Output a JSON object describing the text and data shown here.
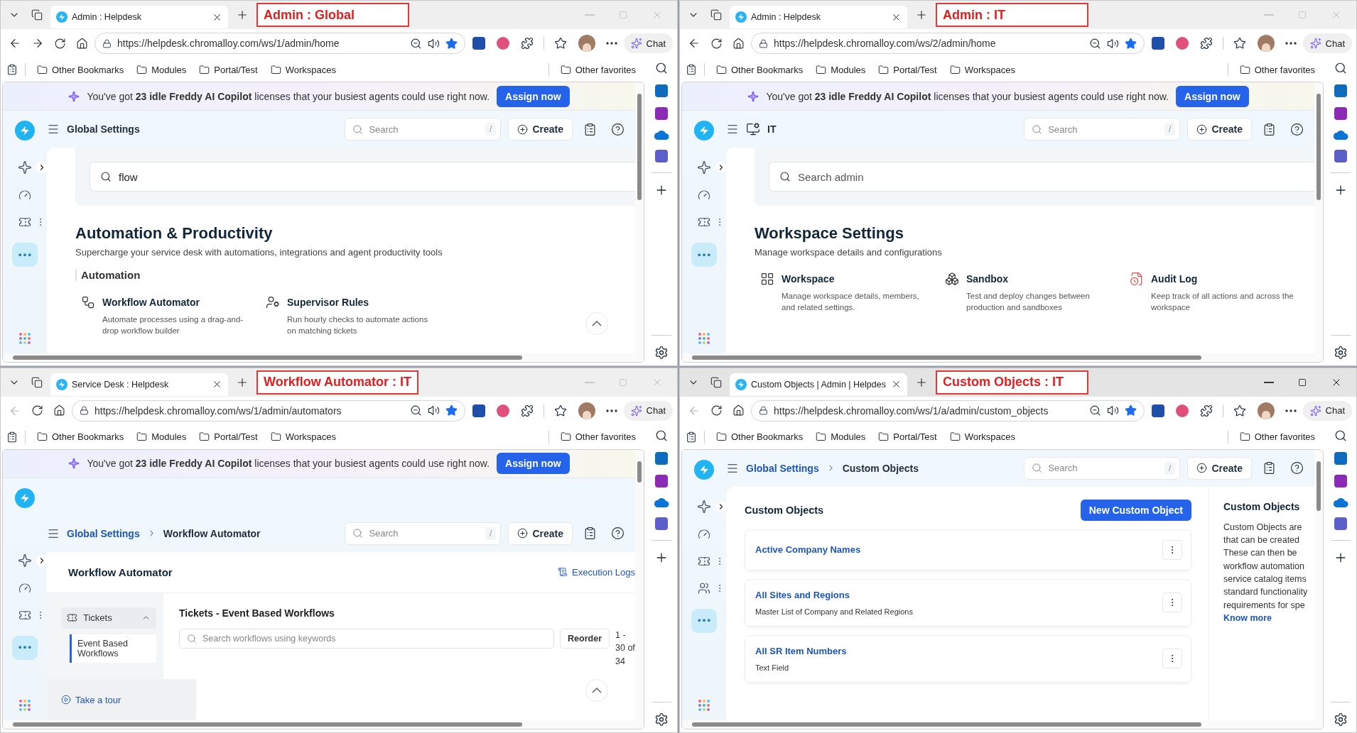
{
  "windows": [
    {
      "tab_title": "Admin : Helpdesk",
      "annotation": "Admin : Global",
      "focused": false,
      "back_enabled": true,
      "forward_button": true,
      "url": "https://helpdesk.chromalloy.com/ws/1/admin/home",
      "chat": "Chat",
      "bookmarks": [
        "Other Bookmarks",
        "Modules",
        "Portal/Test",
        "Workspaces"
      ],
      "other_favorites": "Other favorites",
      "banner": {
        "text": "You've got **23 idle Freddy AI Copilot** licenses that your busiest agents could use right now.",
        "button": "Assign now"
      },
      "header": {
        "workspace_icon": false,
        "breadcrumbs": [
          {
            "label": "Global Settings",
            "link": false
          }
        ],
        "search_placeholder": "Search",
        "search_key": "/",
        "create": "Create"
      },
      "rail_extra_item": false,
      "scroll_top_button": true,
      "page": {
        "kind": "admin_home",
        "search": {
          "value": "flow"
        },
        "heading": "Automation & Productivity",
        "subtitle": "Supercharge your service desk with automations, integrations and agent productivity tools",
        "subheading": "Automation",
        "cards": [
          {
            "title": "Workflow Automator",
            "description": "Automate processes using a drag-and-drop workflow builder"
          },
          {
            "title": "Supervisor Rules",
            "description": "Run hourly checks to automate actions on matching tickets"
          }
        ]
      }
    },
    {
      "tab_title": "Admin : Helpdesk",
      "annotation": "Admin : IT",
      "focused": false,
      "back_enabled": true,
      "forward_button": false,
      "url": "https://helpdesk.chromalloy.com/ws/2/admin/home",
      "chat": "Chat",
      "bookmarks": [
        "Other Bookmarks",
        "Modules",
        "Portal/Test",
        "Workspaces"
      ],
      "other_favorites": "Other favorites",
      "banner": {
        "text": "You've got **23 idle Freddy AI Copilot** licenses that your busiest agents could use right now.",
        "button": "Assign now"
      },
      "header": {
        "workspace_icon": true,
        "breadcrumbs": [
          {
            "label": "IT",
            "link": false
          }
        ],
        "search_placeholder": "Search",
        "search_key": "/",
        "create": "Create"
      },
      "rail_extra_item": false,
      "scroll_top_button": false,
      "page": {
        "kind": "admin_home",
        "search": {
          "placeholder": "Search admin"
        },
        "heading": "Workspace Settings",
        "subtitle": "Manage workspace details and configurations",
        "cards": [
          {
            "title": "Workspace",
            "description": "Manage workspace details, members, and related settings."
          },
          {
            "title": "Sandbox",
            "description": "Test and deploy changes between production and sandboxes"
          },
          {
            "title": "Audit Log",
            "description": "Keep track of all actions and across the workspace"
          }
        ]
      }
    },
    {
      "tab_title": "Service Desk : Helpdesk",
      "annotation": "Workflow Automator : IT",
      "focused": false,
      "back_enabled": false,
      "forward_button": false,
      "url": "https://helpdesk.chromalloy.com/ws/1/admin/automators",
      "chat": "Chat",
      "bookmarks": [
        "Other Bookmarks",
        "Modules",
        "Portal/Test",
        "Workspaces"
      ],
      "other_favorites": "Other favorites",
      "banner": {
        "text": "You've got **23 idle Freddy AI Copilot** licenses that your busiest agents could use right now.",
        "button": "Assign now"
      },
      "header": {
        "workspace_icon": false,
        "breadcrumbs": [
          {
            "label": "Global Settings",
            "link": true
          },
          {
            "label": "Workflow Automator",
            "link": false
          }
        ],
        "search_placeholder": "Search",
        "search_key": "/",
        "create": "Create"
      },
      "rail_extra_item": false,
      "scroll_top_button": true,
      "page": {
        "kind": "automator",
        "title": "Workflow Automator",
        "logs_link": "Execution Logs",
        "nav": {
          "group": "Tickets",
          "expanded": true,
          "items": [
            {
              "label": "Event Based Workflows",
              "selected": true
            }
          ]
        },
        "tour": "Take a tour",
        "heading": "Tickets - Event Based Workflows",
        "search_placeholder": "Search workflows using keywords",
        "reorder": "Reorder",
        "pagination": "1 - 30 of 34"
      }
    },
    {
      "tab_title": "Custom Objects | Admin | Helpdes",
      "annotation": "Custom Objects : IT",
      "focused": true,
      "back_enabled": false,
      "forward_button": false,
      "url": "https://helpdesk.chromalloy.com/ws/1/a/admin/custom_objects",
      "chat": "Chat",
      "bookmarks": [
        "Other Bookmarks",
        "Modules",
        "Portal/Test",
        "Workspaces"
      ],
      "other_favorites": "Other favorites",
      "header": {
        "workspace_icon": false,
        "breadcrumbs": [
          {
            "label": "Global Settings",
            "link": true
          },
          {
            "label": "Custom Objects",
            "link": false
          }
        ],
        "search_placeholder": "Search",
        "search_key": "/",
        "create": "Create"
      },
      "rail_extra_item": true,
      "scroll_top_button": false,
      "page": {
        "kind": "custom_objects",
        "title": "Custom Objects",
        "new_button": "New Custom Object",
        "objects": [
          {
            "name": "Active Company Names"
          },
          {
            "name": "All Sites and Regions",
            "description": "Master List of Company and Related Regions"
          },
          {
            "name": "All SR Item Numbers",
            "description": "Text Field"
          }
        ],
        "info": {
          "title": "Custom Objects",
          "lines": [
            "Custom Objects are",
            "that can be created",
            "These can then be",
            "workflow automation",
            "service catalog items",
            "standard functionality",
            "requirements for spe"
          ],
          "link": "Know more"
        }
      }
    }
  ]
}
